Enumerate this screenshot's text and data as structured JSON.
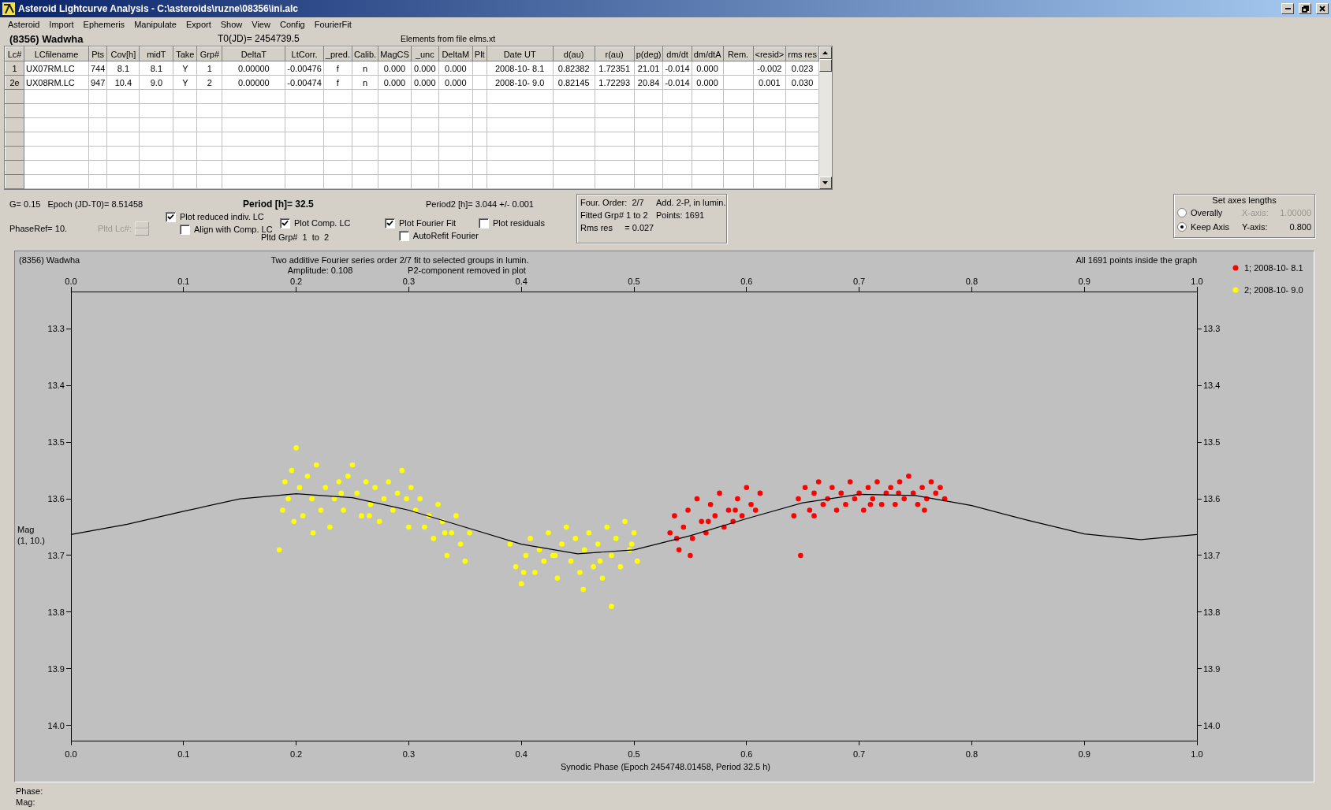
{
  "window": {
    "title": "Asteroid Lightcurve Analysis - C:\\asteroids\\ruzne\\08356\\ini.alc"
  },
  "menu": [
    "Asteroid",
    "Import",
    "Ephemeris",
    "Manipulate",
    "Export",
    "Show",
    "View",
    "Config",
    "FourierFit"
  ],
  "header": {
    "asteroid": "(8356) Wadwha",
    "t0": "T0(JD)= 2454739.5",
    "elements": "Elements from file elms.xt"
  },
  "table": {
    "columns": [
      "Lc#",
      "LCfilename",
      "Pts",
      "Cov[h]",
      "midT",
      "Take",
      "Grp#",
      "DeltaT",
      "LtCorr.",
      "_pred.",
      "Calib.",
      "MagCS",
      "_unc",
      "DeltaM",
      "Plt",
      "Date UT",
      "d(au)",
      "r(au)",
      "p(deg)",
      "dm/dt",
      "dm/dtA",
      "Rem.",
      "<resid>",
      "rms res"
    ],
    "rows": [
      {
        "cells": [
          "1",
          "UX07RM.LC",
          "744",
          "8.1",
          "8.1",
          "Y",
          "1",
          "0.00000",
          "-0.00476",
          "f",
          "n",
          "0.000",
          "0.000",
          "0.000",
          null,
          "2008-10- 8.1",
          "0.82382",
          "1.72351",
          "21.01",
          "-0.014",
          "0.000",
          null,
          "-0.002",
          "0.023"
        ]
      },
      {
        "cells": [
          "2e",
          "UX08RM.LC",
          "947",
          "10.4",
          "9.0",
          "Y",
          "2",
          "0.00000",
          "-0.00474",
          "f",
          "n",
          "0.000",
          "0.000",
          "0.000",
          null,
          "2008-10- 9.0",
          "0.82145",
          "1.72293",
          "20.84",
          "-0.014",
          "0.000",
          null,
          "0.001",
          "0.030"
        ]
      }
    ]
  },
  "controls": {
    "g": "G= 0.15",
    "epoch": "Epoch (JD-T0)= 8.51458",
    "phase_ref": "PhaseRef= 10.",
    "pltd_lc": {
      "label": "Pltd Lc#:",
      "disabled": true
    },
    "period": "Period [h]= 32.5",
    "period2": "Period2 [h]= 3.044 +/- 0.001",
    "pltd_grp": "Pltd Grp#  1  to  2",
    "checkbox_columns": [
      [
        {
          "label": "Plot reduced indiv. LC",
          "checked": true
        },
        {
          "label": "Align with Comp. LC",
          "checked": false
        }
      ],
      [
        {
          "label": "Plot Comp. LC",
          "checked": true
        }
      ],
      [
        {
          "label": "Plot Fourier Fit",
          "checked": true
        },
        {
          "label": "AutoRefit Fourier",
          "checked": false
        }
      ],
      [
        {
          "label": "Plot residuals",
          "checked": false
        }
      ]
    ]
  },
  "fourier_box": {
    "lines": [
      "Four. Order:  2/7",
      "Add. 2-P, in lumin.",
      "Fitted Grp# 1 to 2",
      "Points: 1691",
      "Rms res     = 0.027"
    ]
  },
  "axes_box": {
    "title": "Set axes lengths",
    "options": [
      {
        "label": "Overally",
        "selected": false
      },
      {
        "label": "Keep Axis",
        "selected": true
      }
    ],
    "x_axis": {
      "label": "X-axis:",
      "value": "1.00000",
      "disabled": true
    },
    "y_axis": {
      "label": "Y-axis:",
      "value": "0.800",
      "disabled": false
    }
  },
  "plot": {
    "object": "(8356) Wadwha",
    "title": "Two additive Fourier series order 2/7 fit to selected groups in lumin.",
    "amplitude": "Amplitude: 0.108",
    "note": "P2-component removed in plot",
    "points_note": "All 1691 points inside the graph",
    "mag_label": "Mag",
    "mag_range": "(1, 10.)",
    "chart_data": {
      "type": "scatter",
      "xlabel": "Synodic Phase (Epoch 2454748.01458, Period 32.5 h)",
      "xlim": [
        0,
        1
      ],
      "ylim": [
        14.027,
        13.234
      ],
      "legend": true,
      "xticks": [
        {
          "value": 0,
          "label": "0.0"
        },
        {
          "value": 0.1,
          "label": "0.1"
        },
        {
          "value": 0.2,
          "label": "0.2"
        },
        {
          "value": 0.3,
          "label": "0.3"
        },
        {
          "value": 0.4,
          "label": "0.4"
        },
        {
          "value": 0.5,
          "label": "0.5"
        },
        {
          "value": 0.6,
          "label": "0.6"
        },
        {
          "value": 0.7,
          "label": "0.7"
        },
        {
          "value": 0.8,
          "label": "0.8"
        },
        {
          "value": 0.9,
          "label": "0.9"
        },
        {
          "value": 1,
          "label": "1.0"
        }
      ],
      "yticks": [
        {
          "value": 13.3,
          "label": "13.3"
        },
        {
          "value": 13.4,
          "label": "13.4"
        },
        {
          "value": 13.5,
          "label": "13.5"
        },
        {
          "value": 13.6,
          "label": "13.6"
        },
        {
          "value": 13.7,
          "label": "13.7"
        },
        {
          "value": 13.8,
          "label": "13.8"
        },
        {
          "value": 13.9,
          "label": "13.9"
        },
        {
          "value": 14.0,
          "label": "14.0"
        }
      ],
      "series": [
        {
          "name": "1; 2008-10- 8.1",
          "color": "#ff0000",
          "x": [
            0.532,
            0.536,
            0.54,
            0.544,
            0.548,
            0.552,
            0.556,
            0.56,
            0.564,
            0.568,
            0.572,
            0.576,
            0.58,
            0.584,
            0.588,
            0.592,
            0.596,
            0.6,
            0.604,
            0.608,
            0.612,
            0.55,
            0.642,
            0.646,
            0.648,
            0.652,
            0.656,
            0.66,
            0.664,
            0.668,
            0.672,
            0.676,
            0.68,
            0.684,
            0.688,
            0.692,
            0.696,
            0.7,
            0.704,
            0.708,
            0.712,
            0.716,
            0.72,
            0.724,
            0.728,
            0.732,
            0.736,
            0.74,
            0.744,
            0.748,
            0.752,
            0.756,
            0.76,
            0.764,
            0.768,
            0.772,
            0.776,
            0.538,
            0.566,
            0.59,
            0.66,
            0.71,
            0.735,
            0.758
          ],
          "values": [
            13.66,
            13.63,
            13.69,
            13.65,
            13.62,
            13.67,
            13.6,
            13.64,
            13.66,
            13.61,
            13.63,
            13.59,
            13.65,
            13.62,
            13.64,
            13.6,
            13.63,
            13.58,
            13.61,
            13.62,
            13.59,
            13.7,
            13.63,
            13.6,
            13.7,
            13.58,
            13.62,
            13.59,
            13.57,
            13.61,
            13.6,
            13.58,
            13.62,
            13.59,
            13.61,
            13.57,
            13.6,
            13.59,
            13.62,
            13.58,
            13.6,
            13.57,
            13.61,
            13.59,
            13.58,
            13.61,
            13.57,
            13.6,
            13.56,
            13.59,
            13.61,
            13.58,
            13.6,
            13.57,
            13.59,
            13.58,
            13.6,
            13.67,
            13.64,
            13.62,
            13.63,
            13.61,
            13.59,
            13.62
          ]
        },
        {
          "name": "2; 2008-10- 9.0",
          "color": "#ffff00",
          "x": [
            0.185,
            0.188,
            0.19,
            0.193,
            0.196,
            0.2,
            0.203,
            0.206,
            0.21,
            0.214,
            0.218,
            0.222,
            0.226,
            0.23,
            0.234,
            0.238,
            0.242,
            0.246,
            0.25,
            0.254,
            0.258,
            0.262,
            0.266,
            0.27,
            0.274,
            0.278,
            0.282,
            0.286,
            0.29,
            0.294,
            0.298,
            0.302,
            0.306,
            0.31,
            0.314,
            0.318,
            0.322,
            0.326,
            0.33,
            0.334,
            0.338,
            0.342,
            0.346,
            0.35,
            0.354,
            0.39,
            0.395,
            0.4,
            0.404,
            0.408,
            0.412,
            0.416,
            0.42,
            0.424,
            0.428,
            0.432,
            0.436,
            0.44,
            0.444,
            0.448,
            0.452,
            0.456,
            0.46,
            0.464,
            0.468,
            0.472,
            0.476,
            0.48,
            0.484,
            0.488,
            0.492,
            0.496,
            0.5,
            0.503,
            0.48,
            0.455,
            0.198,
            0.215,
            0.24,
            0.265,
            0.3,
            0.332,
            0.402,
            0.43,
            0.47,
            0.498
          ],
          "values": [
            13.69,
            13.62,
            13.57,
            13.6,
            13.55,
            13.51,
            13.58,
            13.63,
            13.56,
            13.6,
            13.54,
            13.62,
            13.58,
            13.65,
            13.6,
            13.57,
            13.62,
            13.56,
            13.54,
            13.59,
            13.63,
            13.57,
            13.61,
            13.58,
            13.64,
            13.6,
            13.57,
            13.62,
            13.59,
            13.55,
            13.6,
            13.58,
            13.62,
            13.6,
            13.65,
            13.63,
            13.67,
            13.61,
            13.64,
            13.7,
            13.66,
            13.63,
            13.68,
            13.71,
            13.66,
            13.68,
            13.72,
            13.75,
            13.7,
            13.67,
            13.73,
            13.69,
            13.71,
            13.66,
            13.7,
            13.74,
            13.68,
            13.65,
            13.71,
            13.67,
            13.73,
            13.69,
            13.66,
            13.72,
            13.68,
            13.74,
            13.65,
            13.7,
            13.67,
            13.72,
            13.64,
            13.69,
            13.66,
            13.71,
            13.79,
            13.76,
            13.64,
            13.66,
            13.59,
            13.63,
            13.65,
            13.66,
            13.73,
            13.7,
            13.71,
            13.68
          ]
        },
        {
          "color": "#000000",
          "type": "line",
          "x": [
            0,
            0.05,
            0.1,
            0.15,
            0.2,
            0.25,
            0.3,
            0.35,
            0.4,
            0.45,
            0.5,
            0.55,
            0.6,
            0.65,
            0.7,
            0.75,
            0.8,
            0.85,
            0.9,
            0.95,
            1
          ],
          "values": [
            13.663,
            13.645,
            13.622,
            13.6,
            13.591,
            13.598,
            13.62,
            13.65,
            13.68,
            13.697,
            13.69,
            13.665,
            13.635,
            13.607,
            13.592,
            13.594,
            13.612,
            13.638,
            13.662,
            13.672,
            13.663
          ]
        }
      ]
    }
  },
  "status": [
    "Phase:",
    "Mag:"
  ]
}
